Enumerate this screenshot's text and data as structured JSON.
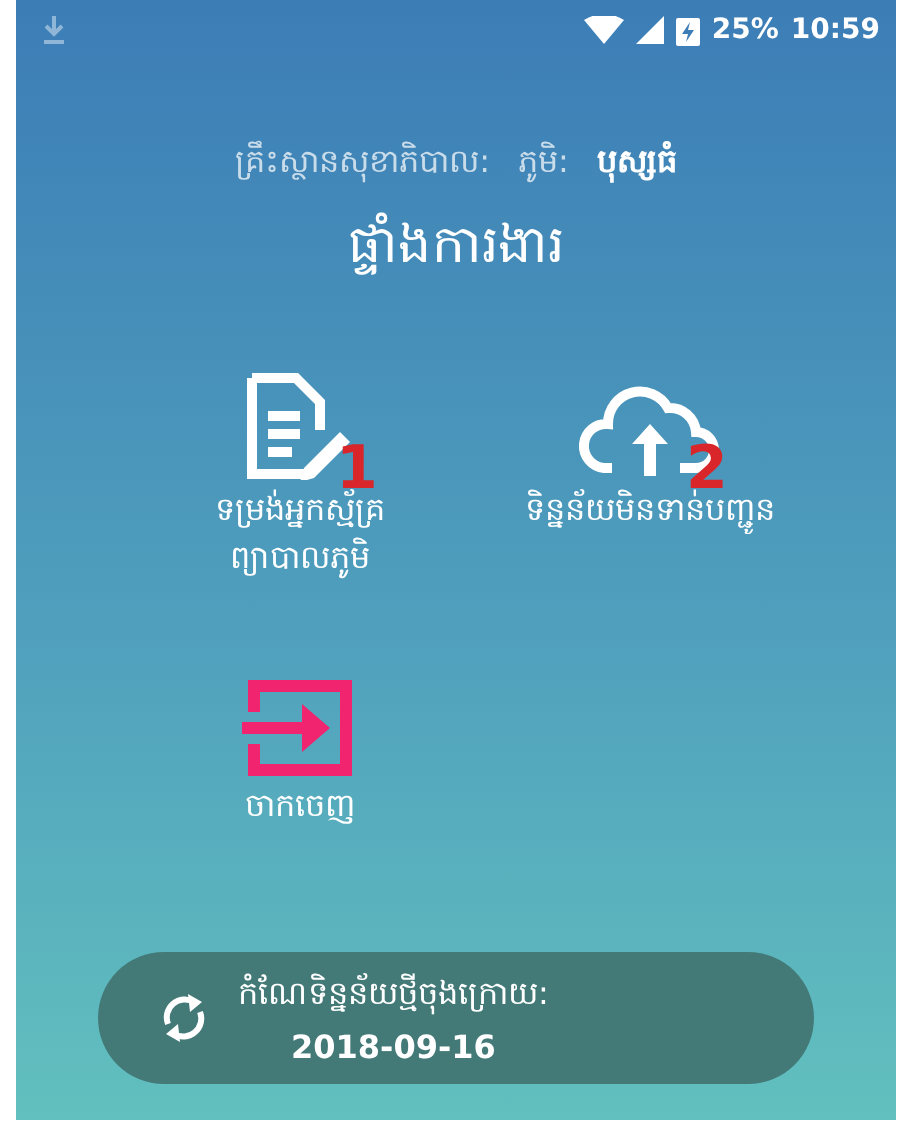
{
  "status_bar": {
    "battery": "25%",
    "time": "10:59"
  },
  "header": {
    "facility_label": "គ្រឹះស្ថានសុខាភិបាល:",
    "village_label": "ភូមិ:",
    "village": "បុស្សធំ"
  },
  "title": "ផ្ទាំងការងារ",
  "tiles": [
    {
      "kind": "form",
      "label": "ទម្រង់អ្នកស្ម័គ្រព្យាបាលភូមិ",
      "badge": "1"
    },
    {
      "kind": "upload",
      "label": "ទិន្នន័យមិនទាន់បញ្ជូន",
      "badge": "2"
    },
    {
      "kind": "logout",
      "label": "ចាកចេញ"
    }
  ],
  "sync": {
    "label": "កំណែទិន្នន័យថ្មីចុងក្រោយ:",
    "date": "2018-09-16"
  }
}
